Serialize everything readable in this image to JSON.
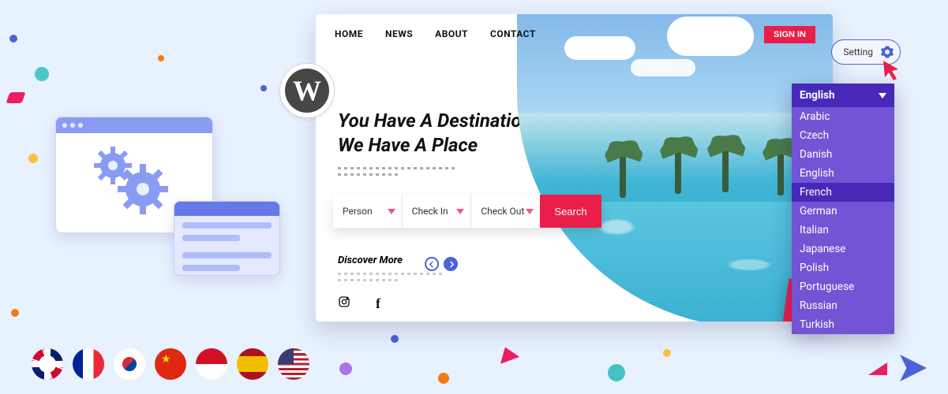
{
  "nav": {
    "home": "HOME",
    "news": "NEWS",
    "about": "ABOUT",
    "contact": "CONTACT"
  },
  "auth": {
    "signin": "SIGN IN"
  },
  "headline": {
    "line1": "You Have A Destination,",
    "line2": "We Have A Place"
  },
  "search": {
    "person": "Person",
    "checkin": "Check In",
    "checkout": "Check Out",
    "button": "Search"
  },
  "discover": {
    "label": "Discover More"
  },
  "settings": {
    "label": "Setting"
  },
  "language": {
    "selected": "English",
    "options": [
      "Arabic",
      "Czech",
      "Danish",
      "English",
      "French",
      "German",
      "Italian",
      "Japanese",
      "Polish",
      "Portuguese",
      "Russian",
      "Turkish"
    ],
    "highlighted": "French"
  },
  "wordpress": {
    "glyph": "W"
  },
  "flags": [
    "uk",
    "fr",
    "kr",
    "cn",
    "id",
    "es",
    "us"
  ]
}
